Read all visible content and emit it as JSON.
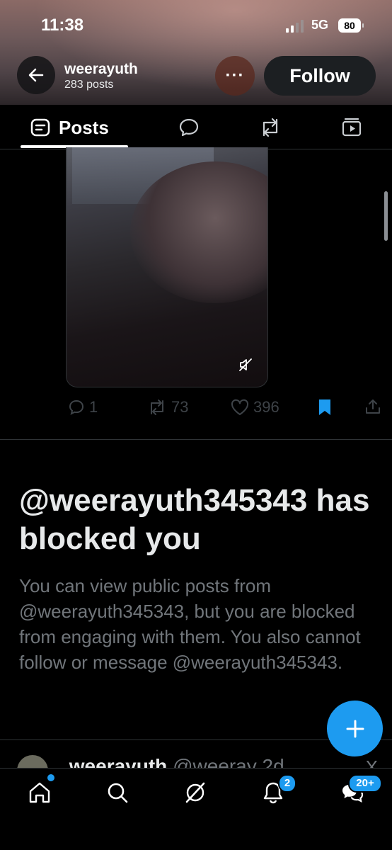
{
  "status_bar": {
    "time": "11:38",
    "network": "5G",
    "battery": "80"
  },
  "header": {
    "name": "weerayuth",
    "post_count": "283 posts",
    "more_label": "···",
    "follow_label": "Follow"
  },
  "tabs": {
    "posts_label": "Posts"
  },
  "post_actions": {
    "replies": "1",
    "reposts": "73",
    "likes": "396"
  },
  "blocked_notice": {
    "title": "@weerayuth345343 has blocked you",
    "body": "You can view public posts from @weerayuth345343, but you are blocked from engaging with them. You also cannot follow or message @weerayuth345343."
  },
  "next_post_peek": {
    "name": "weerayuth",
    "handle": "@weeray",
    "time": "2d",
    "close": "X"
  },
  "bottom_nav": {
    "notifications_badge": "2",
    "messages_badge": "20+"
  },
  "colors": {
    "accent": "#1d9bf0",
    "background": "#000000",
    "muted_text": "#71767b"
  }
}
